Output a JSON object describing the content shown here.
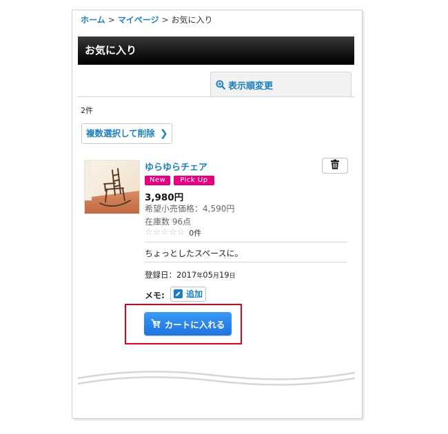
{
  "breadcrumb": {
    "home": "ホーム",
    "sep1": ">",
    "mypage": "マイページ",
    "sep2": ">",
    "current": "お気に入り"
  },
  "page": {
    "title": "お気に入り",
    "sort_label": "表示順変更",
    "count": "2件",
    "bulk_delete_label": "複数選択して削除"
  },
  "item": {
    "name": "ゆらゆらチェア",
    "badges": [
      "New",
      "Pick Up"
    ],
    "price": "3,980円",
    "msrp": "希望小売価格：4,590円",
    "stock": "在庫数 96点",
    "rating_stars": 0,
    "review_count": "0件",
    "description": "ちょっとしたスペースに。",
    "date_label": "登録日：",
    "date_year": "2017",
    "date_year_unit": "年",
    "date_month": "05",
    "date_month_unit": "月",
    "date_day": "19",
    "date_day_unit": "日",
    "memo_label": "メモ:",
    "memo_add_label": "追加",
    "cart_label": "カートに入れる"
  },
  "colors": {
    "link": "#1b7fbf",
    "badge": "#e4007f",
    "cart_button": "#2a86ee",
    "highlight": "#e0001b"
  },
  "icons": {
    "sort": "zoom-in-icon",
    "delete": "trash-icon",
    "memo": "pencil-icon",
    "cart": "cart-icon",
    "bulk_delete": "chevron-right-icon"
  }
}
